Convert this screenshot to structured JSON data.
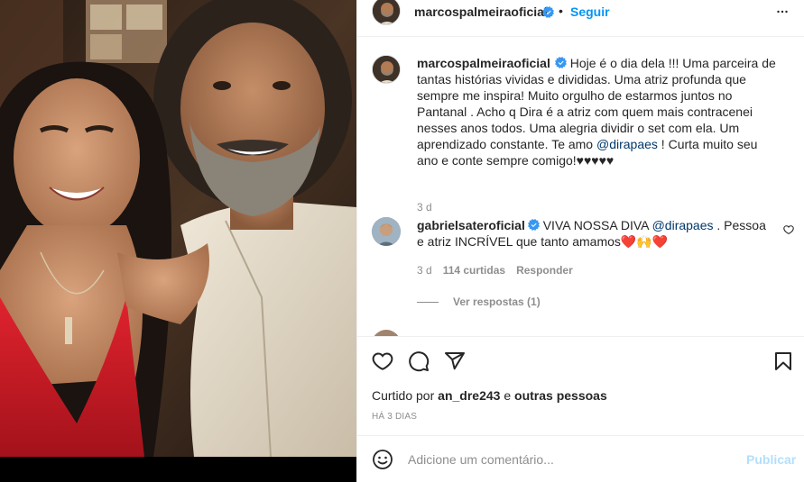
{
  "post": {
    "username": "marcospalmeiraoficial",
    "separator": "•",
    "follow_label": "Seguir",
    "more_icon": "more-horizontal-icon"
  },
  "caption": {
    "username": "marcospalmeiraoficial",
    "text_part1": "Hoje é o dia dela !!! Uma parceira de tantas histórias vividas e divididas. Uma atriz profunda que sempre me inspira! Muito orgulho de estarmos juntos no Pantanal . Acho q Dira é a atriz com quem mais contracenei nesses anos todos. Uma alegria dividir o set com ela. Um aprendizado constante. Te amo ",
    "mention": "@dirapaes",
    "text_part2": " ! Curta muito seu ano e conte sempre comigo!♥♥♥♥♥",
    "time": "3 d"
  },
  "comment": {
    "username": "gabrielsateroficial",
    "text_part1": "VIVA NOSSA DIVA ",
    "mention": "@dirapaes",
    "text_part2": " . Pessoa e atriz INCRÍVEL que tanto amamos",
    "emoji": "❤️🙌❤️",
    "time": "3 d",
    "likes": "114 curtidas",
    "reply_label": "Responder",
    "view_replies": "Ver respostas (1)"
  },
  "likes": {
    "prefix": "Curtido por ",
    "user": "an_dre243",
    "connector": " e ",
    "others": "outras pessoas"
  },
  "post_date": "HÁ 3 DIAS",
  "add_comment": {
    "placeholder": "Adicione um comentário...",
    "publish_label": "Publicar"
  },
  "colors": {
    "accent": "#0095f6",
    "publish_disabled": "#b2dffc",
    "verified": "#3897f0",
    "mention": "#00376b",
    "like_heart": "#ed4956"
  },
  "icons": [
    "verified-badge-icon",
    "heart-icon",
    "comment-icon",
    "share-icon",
    "save-bookmark-icon",
    "emoji-icon",
    "more-horizontal-icon"
  ]
}
